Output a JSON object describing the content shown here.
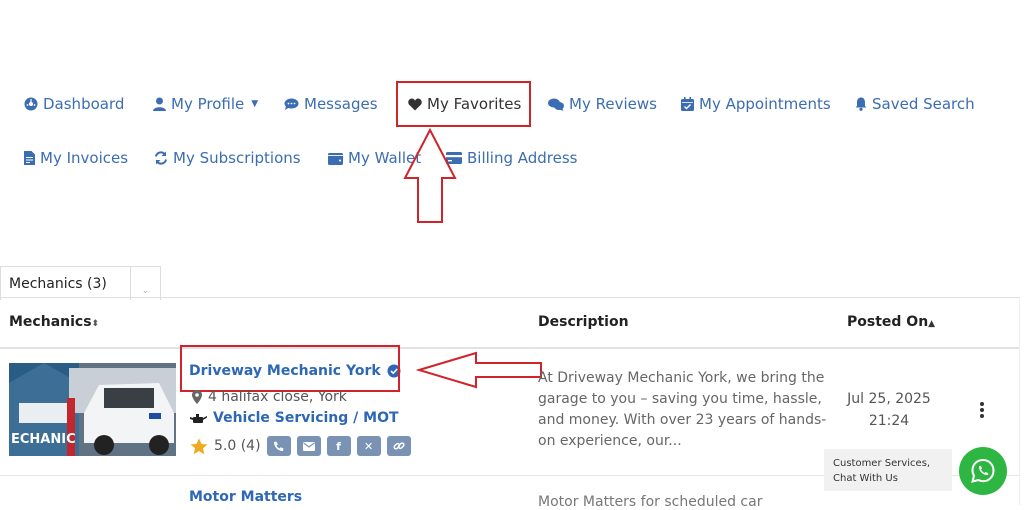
{
  "nav": {
    "items": [
      {
        "label": "Dashboard",
        "icon": "dashboard-icon"
      },
      {
        "label": "My Profile",
        "icon": "user-icon",
        "has_caret": true
      },
      {
        "label": "Messages",
        "icon": "chat-icon"
      },
      {
        "label": "My Favorites",
        "icon": "heart-icon",
        "active": true
      },
      {
        "label": "My Reviews",
        "icon": "reviews-icon"
      },
      {
        "label": "My Appointments",
        "icon": "calendar-check-icon"
      },
      {
        "label": "Saved Search",
        "icon": "bell-icon"
      },
      {
        "label": "My Invoices",
        "icon": "invoice-icon"
      },
      {
        "label": "My Subscriptions",
        "icon": "sync-icon"
      },
      {
        "label": "My Wallet",
        "icon": "wallet-icon"
      },
      {
        "label": "Billing Address",
        "icon": "credit-card-icon"
      }
    ]
  },
  "filter": {
    "selected": "Mechanics (3)"
  },
  "table": {
    "headers": {
      "mechanics": "Mechanics",
      "description": "Description",
      "posted_on": "Posted On"
    },
    "rows": [
      {
        "title": "Driveway Mechanic York",
        "verified": true,
        "address": "4 halifax close, York",
        "category": "Vehicle Servicing / MOT",
        "rating": "5.0 (4)",
        "description": "At Driveway Mechanic York, we bring the garage to you – saving you time, hassle, and money. With over 23 years of hands-on experience, our...",
        "posted_date": "Jul 25, 2025",
        "posted_time": "21:24",
        "thumb_text": "ECHANIC"
      },
      {
        "title": "Motor Matters",
        "description": "Motor Matters for scheduled car"
      }
    ]
  },
  "chat": {
    "tooltip": "Customer Services, Chat With Us"
  },
  "colors": {
    "accent": "#3b6db3",
    "annotation": "#d1232a",
    "whatsapp": "#2db742",
    "social": "#7a93b4"
  }
}
